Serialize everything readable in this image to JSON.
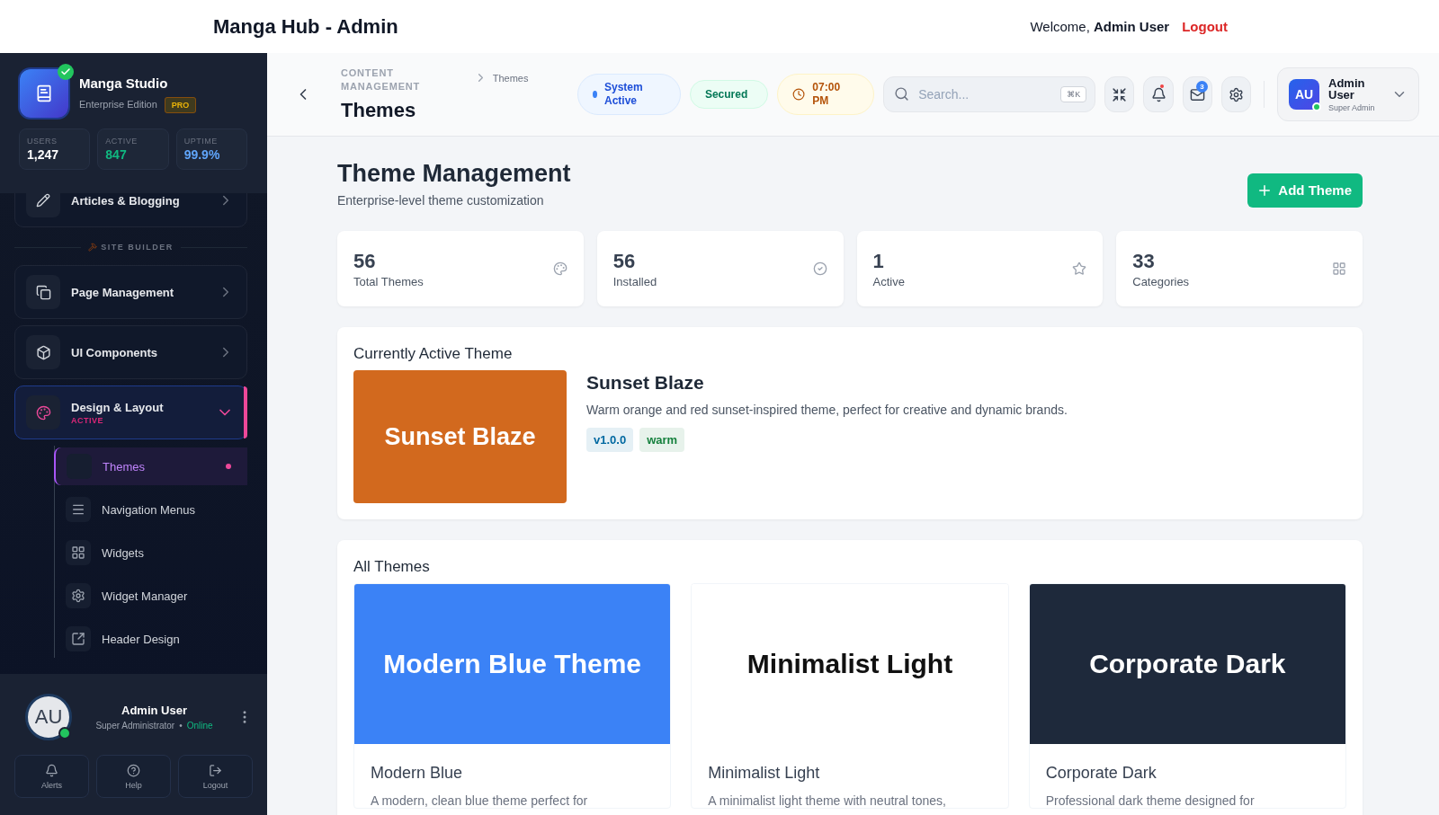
{
  "header": {
    "title": "Manga Hub - Admin",
    "welcome": "Welcome,",
    "user": "Admin User",
    "logout": "Logout"
  },
  "sidebar": {
    "brand": {
      "name": "Manga Studio",
      "edition": "Enterprise Edition",
      "badge": "PRO",
      "verified": true
    },
    "stats": [
      {
        "label": "USERS",
        "value": "1,247",
        "color": "#ffffff"
      },
      {
        "label": "ACTIVE",
        "value": "847",
        "color": "#10b981"
      },
      {
        "label": "UPTIME",
        "value": "99.9%",
        "color": "#60a5fa"
      }
    ],
    "partial_item": {
      "label": "Articles & Blogging",
      "selected": false
    },
    "section": "SITE BUILDER",
    "items": [
      {
        "label": "Page Management",
        "selected": false,
        "expanded": false
      },
      {
        "label": "UI Components",
        "selected": false,
        "expanded": false
      },
      {
        "label": "Design & Layout",
        "badge": "ACTIVE",
        "selected": true,
        "expanded": true,
        "children": [
          {
            "label": "Themes",
            "selected": true
          },
          {
            "label": "Navigation Menus",
            "selected": false
          },
          {
            "label": "Widgets",
            "selected": false
          },
          {
            "label": "Widget Manager",
            "selected": false
          },
          {
            "label": "Header Design",
            "selected": false
          }
        ]
      }
    ],
    "footer": {
      "initials": "AU",
      "name": "Admin User",
      "role": "Super Administrator",
      "separator": "•",
      "status": "Online",
      "online": true,
      "actions": [
        "Alerts",
        "Help",
        "Logout"
      ]
    }
  },
  "topbar": {
    "breadcrumb": [
      "CONTENT MANAGEMENT",
      "Themes"
    ],
    "title": "Themes",
    "status": [
      {
        "kind": "dot",
        "label": "System Active"
      },
      {
        "kind": "plain",
        "label": "Secured"
      },
      {
        "kind": "clock",
        "label": "07:00 PM"
      }
    ],
    "search": {
      "placeholder": "Search...",
      "shortcut": "⌘K"
    },
    "notifications": {
      "unread": true
    },
    "messages": {
      "count": "3"
    },
    "user": {
      "initials": "AU",
      "name": "Admin User",
      "role": "Super Admin",
      "online": true
    }
  },
  "content": {
    "title": "Theme Management",
    "subtitle": "Enterprise-level theme customization",
    "add_button": "Add Theme",
    "stats": [
      {
        "value": "56",
        "label": "Total Themes"
      },
      {
        "value": "56",
        "label": "Installed"
      },
      {
        "value": "1",
        "label": "Active"
      },
      {
        "value": "33",
        "label": "Categories"
      }
    ],
    "active_theme": {
      "heading": "Currently Active Theme",
      "preview": "Sunset Blaze",
      "color": "#d2691e",
      "name": "Sunset Blaze",
      "description": "Warm orange and red sunset-inspired theme, perfect for creative and dynamic brands.",
      "tags": [
        {
          "label": "v1.0.0",
          "color": "#0369a1"
        },
        {
          "label": "warm",
          "color": "#15803d"
        }
      ]
    },
    "all_themes": {
      "heading": "All Themes",
      "themes": [
        {
          "preview": "Modern Blue Theme",
          "color": "#3b82f6",
          "name": "Modern Blue",
          "description": "A modern, clean blue theme perfect for"
        },
        {
          "preview": "Minimalist Light",
          "color": "#ffffff",
          "name": "Minimalist Light",
          "description": "A minimalist light theme with neutral tones,"
        },
        {
          "preview": "Corporate Dark",
          "color": "#1e293b",
          "name": "Corporate Dark",
          "description": "Professional dark theme designed for"
        }
      ]
    }
  }
}
